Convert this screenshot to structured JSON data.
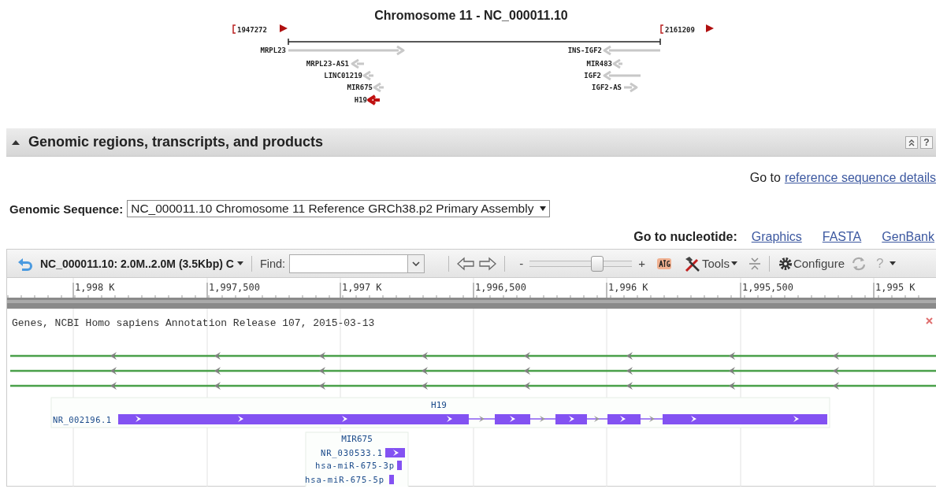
{
  "chromosome_map": {
    "title": "Chromosome 11 - NC_000011.10",
    "range_start": "1947272",
    "range_end": "2161209",
    "genes": [
      {
        "name": "MRPL23",
        "reverse_strand": false,
        "selected": false
      },
      {
        "name": "MRPL23-AS1",
        "reverse_strand": true,
        "selected": false
      },
      {
        "name": "LINC01219",
        "reverse_strand": true,
        "selected": false
      },
      {
        "name": "MIR675",
        "reverse_strand": true,
        "selected": false
      },
      {
        "name": "H19",
        "reverse_strand": true,
        "selected": true
      },
      {
        "name": "INS-IGF2",
        "reverse_strand": true,
        "selected": false
      },
      {
        "name": "MIR483",
        "reverse_strand": true,
        "selected": false
      },
      {
        "name": "IGF2",
        "reverse_strand": true,
        "selected": false
      },
      {
        "name": "IGF2-AS",
        "reverse_strand": false,
        "selected": false
      }
    ]
  },
  "section": {
    "title": "Genomic regions, transcripts, and products",
    "expanded": true,
    "help": "?"
  },
  "reference_link": {
    "prefix": "Go to",
    "link": "reference sequence details"
  },
  "genomic_sequence": {
    "label": "Genomic Sequence:",
    "value": "NC_000011.10 Chromosome 11 Reference GRCh38.p2 Primary Assembly"
  },
  "nucleotide_links": {
    "label": "Go to nucleotide:",
    "links": [
      "Graphics",
      "FASTA",
      "GenBank"
    ]
  },
  "viewer": {
    "title": "NC_000011.10: 2.0M..2.0M (3.5Kbp) C",
    "find_label": "Find:",
    "zoom_minus": "-",
    "zoom_plus": "+",
    "zoom": {
      "level": 0.65
    },
    "tools": "Tools",
    "configure": "Configure",
    "help": "?",
    "ruler": [
      "1,998 K",
      "1,997,500",
      "1,997 K",
      "1,996,500",
      "1,996 K",
      "1,995,500",
      "1,995 K"
    ],
    "track_title": "Genes, NCBI Homo sapiens Annotation Release 107, 2015-03-13",
    "features": [
      {
        "gene": "H19",
        "transcript": "NR_002196.1"
      },
      {
        "gene": "MIR675",
        "transcript": "NR_030533.1",
        "products": [
          "hsa-miR-675-3p",
          "hsa-miR-675-5p"
        ]
      }
    ]
  }
}
